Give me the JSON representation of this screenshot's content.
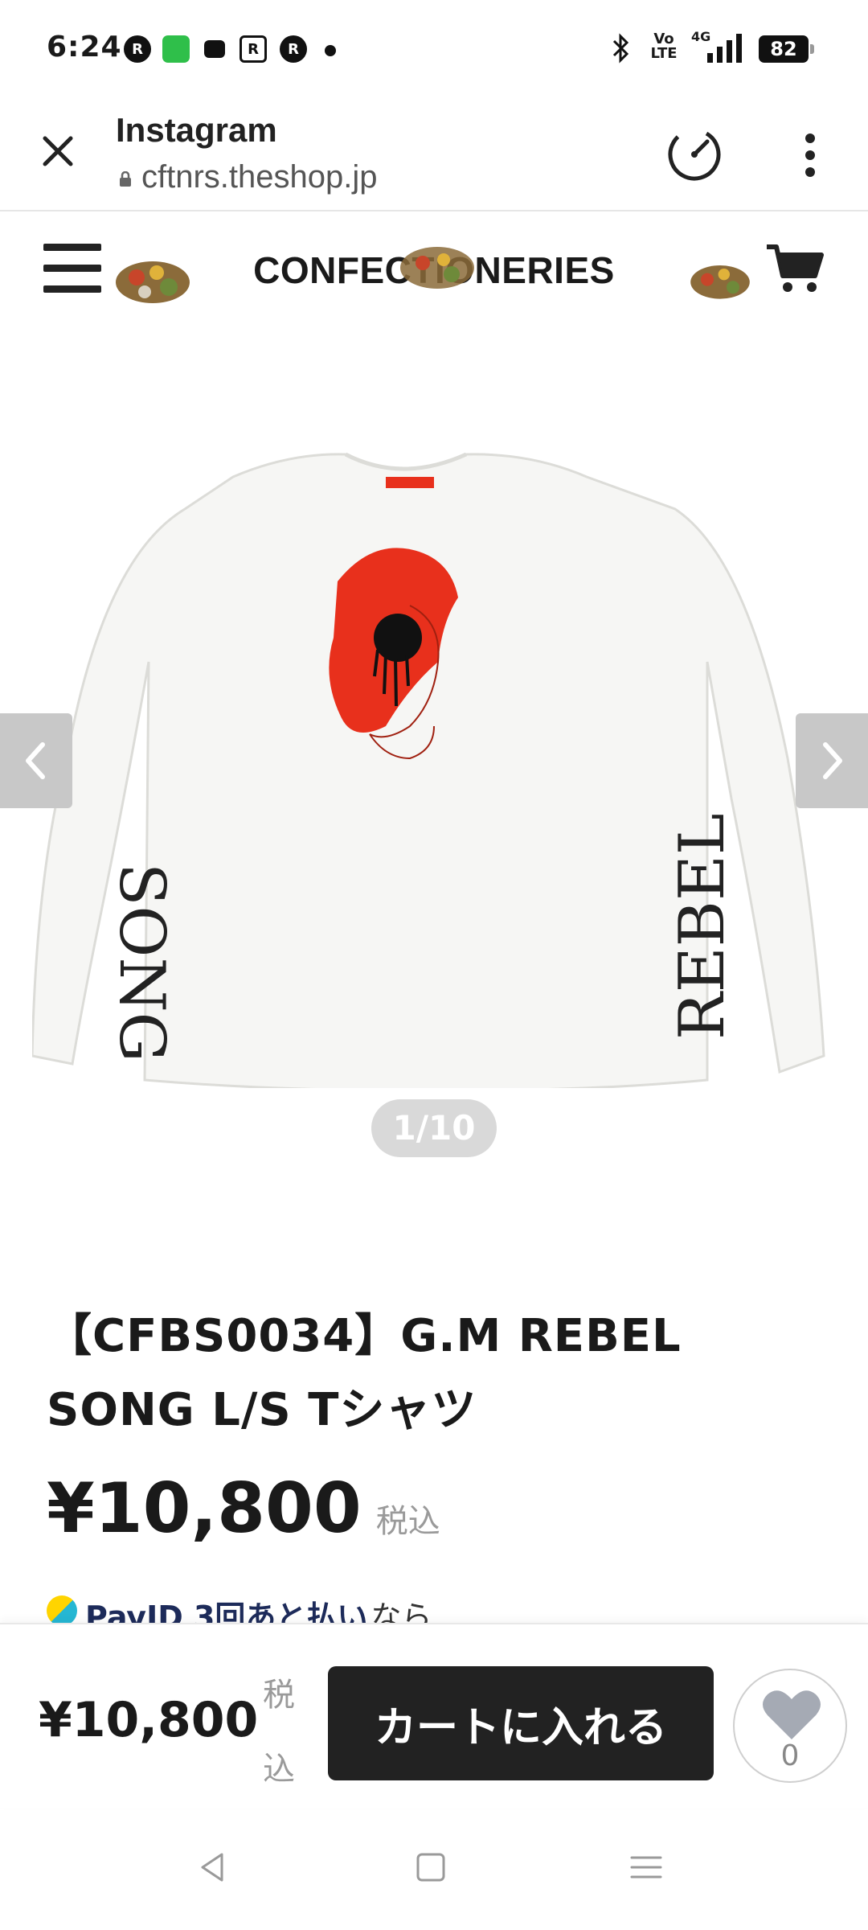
{
  "status_bar": {
    "time": "6:24",
    "notifications": [
      "R",
      "",
      "",
      "R",
      "R"
    ],
    "network": "4G",
    "volte": "Vo\nLTE",
    "battery": "82"
  },
  "browser": {
    "title": "Instagram",
    "url": "cftnrs.theshop.jp"
  },
  "shop": {
    "logo": "CONFECTIONERIES"
  },
  "carousel": {
    "counter": "1/10",
    "image_left_sleeve_text": "SONG",
    "image_right_sleeve_text": "REBEL"
  },
  "product": {
    "title": "【CFBS0034】G.M REBEL SONG L/S Tシャツ",
    "price": "¥10,800",
    "tax_label": "税込",
    "payid_text": "PayID 3回あと払い",
    "payid_tail": "なら"
  },
  "bottom_bar": {
    "price": "¥10,800",
    "tax_label": "税込",
    "cart_button": "カートに入れる",
    "fav_count": "0"
  },
  "colors": {
    "accent_red": "#e8301c",
    "button_dark": "#222222",
    "arrow_gray": "#c8c8c8"
  }
}
